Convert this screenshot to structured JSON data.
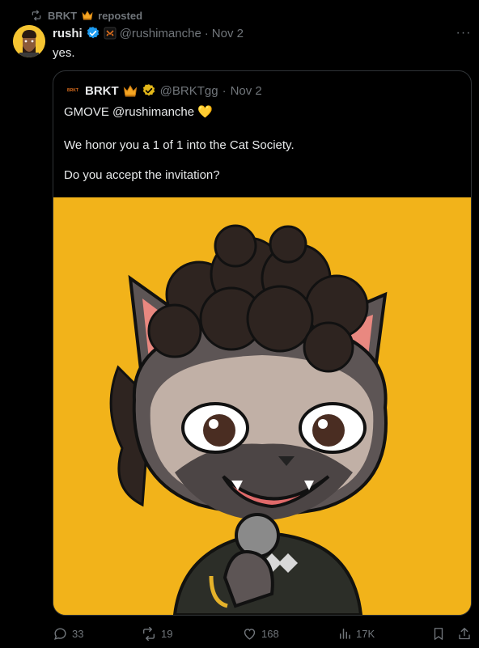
{
  "repost": {
    "by": "BRKT",
    "label": "reposted",
    "icon": "repost-icon"
  },
  "tweet": {
    "author_name": "rushi",
    "handle": "@rushimanche",
    "separator": "·",
    "date": "Nov 2",
    "text": "yes.",
    "more_label": "···"
  },
  "quote": {
    "author_name": "BRKT",
    "logo_text": "BRKT",
    "handle": "@BRKTgg",
    "separator": "·",
    "date": "Nov 2",
    "line1": "GMOVE @rushimanche 💛",
    "line2": "We honor you a 1 of 1 into the Cat Society.",
    "line3": "Do you accept the invitation?"
  },
  "actions": {
    "replies": "33",
    "reposts": "19",
    "likes": "168",
    "views": "17K"
  },
  "colors": {
    "background": "#000000",
    "text": "#e7e9ea",
    "muted": "#71767b",
    "verified_blue": "#1d9bf0",
    "verified_gold": "#e2b719",
    "image_bg": "#f2b31a"
  }
}
